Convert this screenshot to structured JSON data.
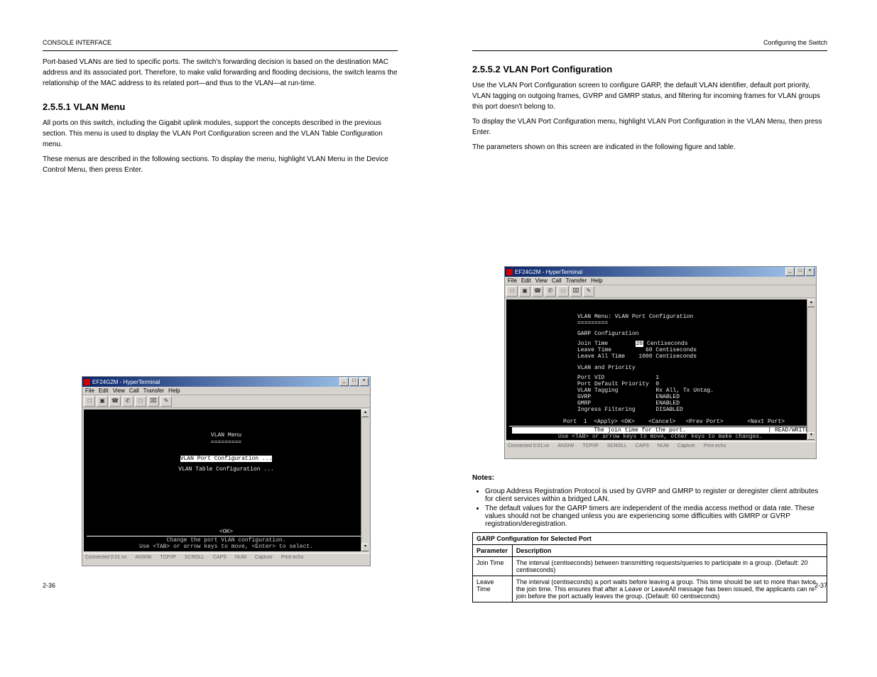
{
  "leftPage": {
    "hdrLeft": "CONSOLE INTERFACE",
    "hdrRight": "",
    "pageNum": "2-36",
    "para1": "Port-based VLANs are tied to specific ports. The switch's forwarding decision is based on the destination MAC address and its associated port. Therefore, to make valid forwarding and flooding decisions, the switch learns the relationship of the MAC address to its related port—and thus to the VLAN—at run-time.",
    "sec1": "2.5.5.1 VLAN Menu",
    "para2": "All ports on this switch, including the Gigabit uplink modules, support the concepts described in the previous section. This menu is used to display the VLAN Port Configuration screen and the VLAN Table Configuration menu.",
    "para3": "These menus are described in the following sections. To display the menu, highlight VLAN Menu in the Device Control Menu, then press Enter."
  },
  "rightPage": {
    "hdrLeft": "",
    "hdrRight": "Configuring the Switch",
    "pageNum": "2-37",
    "sec1": "2.5.5.2 VLAN Port Configuration",
    "para1": "Use the VLAN Port Configuration screen to configure GARP, the default VLAN identifier, default port priority, VLAN tagging on outgoing frames, GVRP and GMRP status, and filtering for incoming frames for VLAN groups this port doesn't belong to.",
    "para2": "To display the VLAN Port Configuration menu, highlight VLAN Port Configuration in the VLAN Menu, then press Enter.",
    "para3": "The parameters shown on this screen are indicated in the following figure and table.",
    "tableCaption": "GARP Configuration for Selected Port",
    "params": [
      {
        "p": "Join Time",
        "d": "The interval (centiseconds) between transmitting requests/queries to participate in a group. (Default: 20 centiseconds)"
      },
      {
        "p": "Leave Time",
        "d": "The interval (centiseconds) a port waits before leaving a group. This time should be set to more than twice the join time. This ensures that after a Leave or LeaveAll message has been issued, the applicants can re-join before the port actually leaves the group. (Default: 60 centiseconds)"
      }
    ],
    "notesLabel": "Notes:",
    "notes": [
      "Group Address Registration Protocol is used by GVRP and GMRP to register or deregister client attributes for client services within a bridged LAN.",
      "The default values for the GARP timers are independent of the media access method or data rate. These values should not be changed unless you are experiencing some difficulties with GMRP or GVRP registration/deregistration."
    ]
  },
  "shot1": {
    "title": "EF24G2M - HyperTerminal",
    "menus": [
      "File",
      "Edit",
      "View",
      "Call",
      "Transfer",
      "Help"
    ],
    "heading": "VLAN Menu",
    "dashes": "=========",
    "line1": "VLAN Port Configuration ...",
    "line2": "VLAN Table Configuration ...",
    "ok": "<OK>",
    "hint1": "Change the port VLAN configuration.",
    "hint2": "Use <TAB> or arrow keys to move, <Enter> to select.",
    "status": [
      "Connected 0:01:xx",
      "ANSIW",
      "TCP/IP",
      "SCROLL",
      "CAPS",
      "NUM",
      "Capture",
      "Print echo"
    ]
  },
  "shot2": {
    "title": "EF24G2M - HyperTerminal",
    "menus": [
      "File",
      "Edit",
      "View",
      "Call",
      "Transfer",
      "Help"
    ],
    "heading": "VLAN Menu: VLAN Port Configuration",
    "dashes": "=========",
    "sub1": "GARP Configuration",
    "join": "Join Time        ",
    "joinVal": "20",
    "joinUnit": " Centiseconds",
    "leave": "Leave Time          60 Centiseconds",
    "leaveAll": "Leave All Time    1000 Centiseconds",
    "sub2": "VLAN and Priority",
    "row1": "Port VID               1",
    "row2": "Port Default Priority  0",
    "row3": "VLAN Tagging           Rx All, Tx Untag.",
    "row4": "GVRP                   ENABLED",
    "row5": "GMRP                   ENABLED",
    "row6": "Ingress Filtering      DISABLED",
    "nav": "Port  1  <Apply> <OK>    <Cancel>   <Prev Port>       <Next Port>",
    "hint1": "The join time for the port.",
    "rw": "| READ/WRITE",
    "hint2": "Use <TAB> or arrow keys to move, other keys to make changes.",
    "status": [
      "Connected 0:01:xx",
      "ANSIW",
      "TCP/IP",
      "SCROLL",
      "CAPS",
      "NUM",
      "Capture",
      "Print echo"
    ]
  }
}
